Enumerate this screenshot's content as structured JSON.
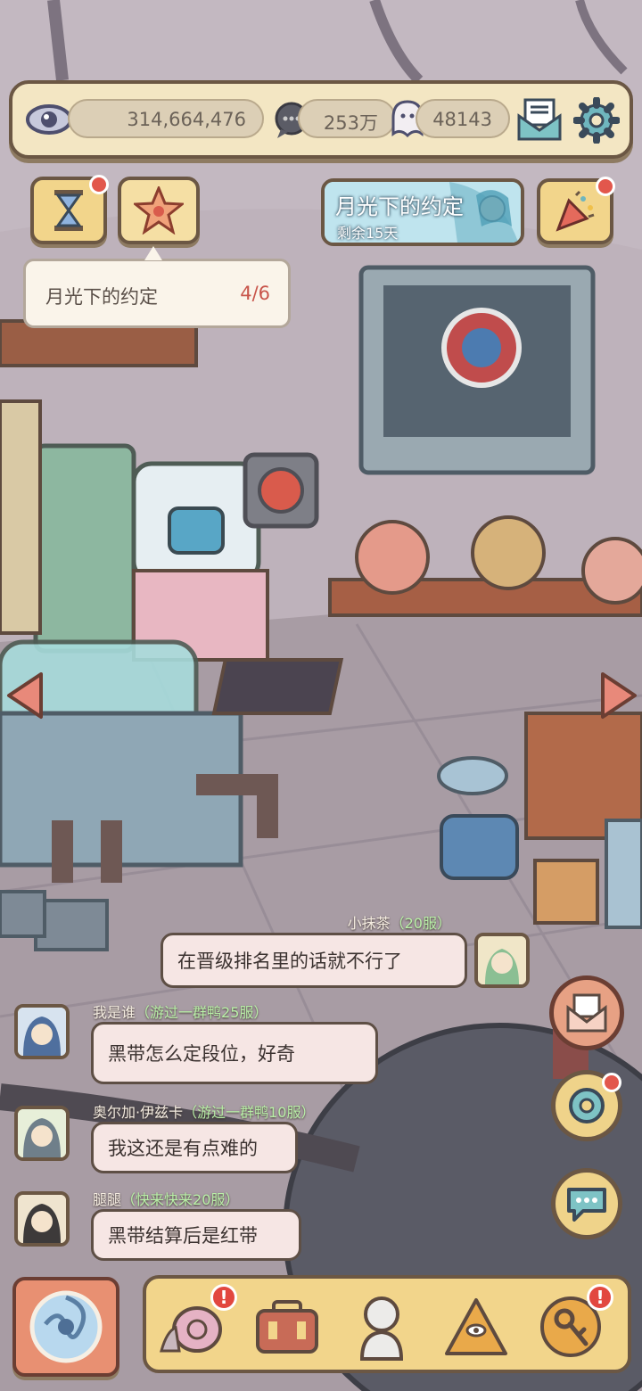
{
  "resources": {
    "eye_value": "314,664,476",
    "bubble_value": "253万",
    "ghost_value": "48143"
  },
  "event": {
    "title": "月光下的约定",
    "remaining": "剩余15天"
  },
  "quest": {
    "name": "月光下的约定",
    "progress": "4/6"
  },
  "chat": [
    {
      "nick": "小抹茶",
      "server": "（20服）",
      "text": "在晋级排名里的话就不行了"
    },
    {
      "nick": "我是谁",
      "server": "（游过一群鸭25服）",
      "text": "黑带怎么定段位，好奇"
    },
    {
      "nick": "奥尔加·伊兹卡",
      "server": "（游过一群鸭10服）",
      "text": "我这还是有点难的"
    },
    {
      "nick": "腿腿",
      "server": "（快来快来20服）",
      "text": "黑带结算后是红带"
    }
  ],
  "icons": [
    "eye-icon",
    "speech-bubble-icon",
    "ghost-icon",
    "mail-icon",
    "gear-icon",
    "hourglass-icon",
    "star-icon",
    "party-popper-icon",
    "left-arrow-icon",
    "right-arrow-icon",
    "letter-icon",
    "donut-icon",
    "chat-icon",
    "portal-icon",
    "snail-icon",
    "suitcase-icon",
    "statue-icon",
    "pyramid-eye-icon",
    "key-icon"
  ],
  "colors": {
    "alert": "#e2473f",
    "frame": "#6b5744",
    "panel": "#f2d58b"
  }
}
